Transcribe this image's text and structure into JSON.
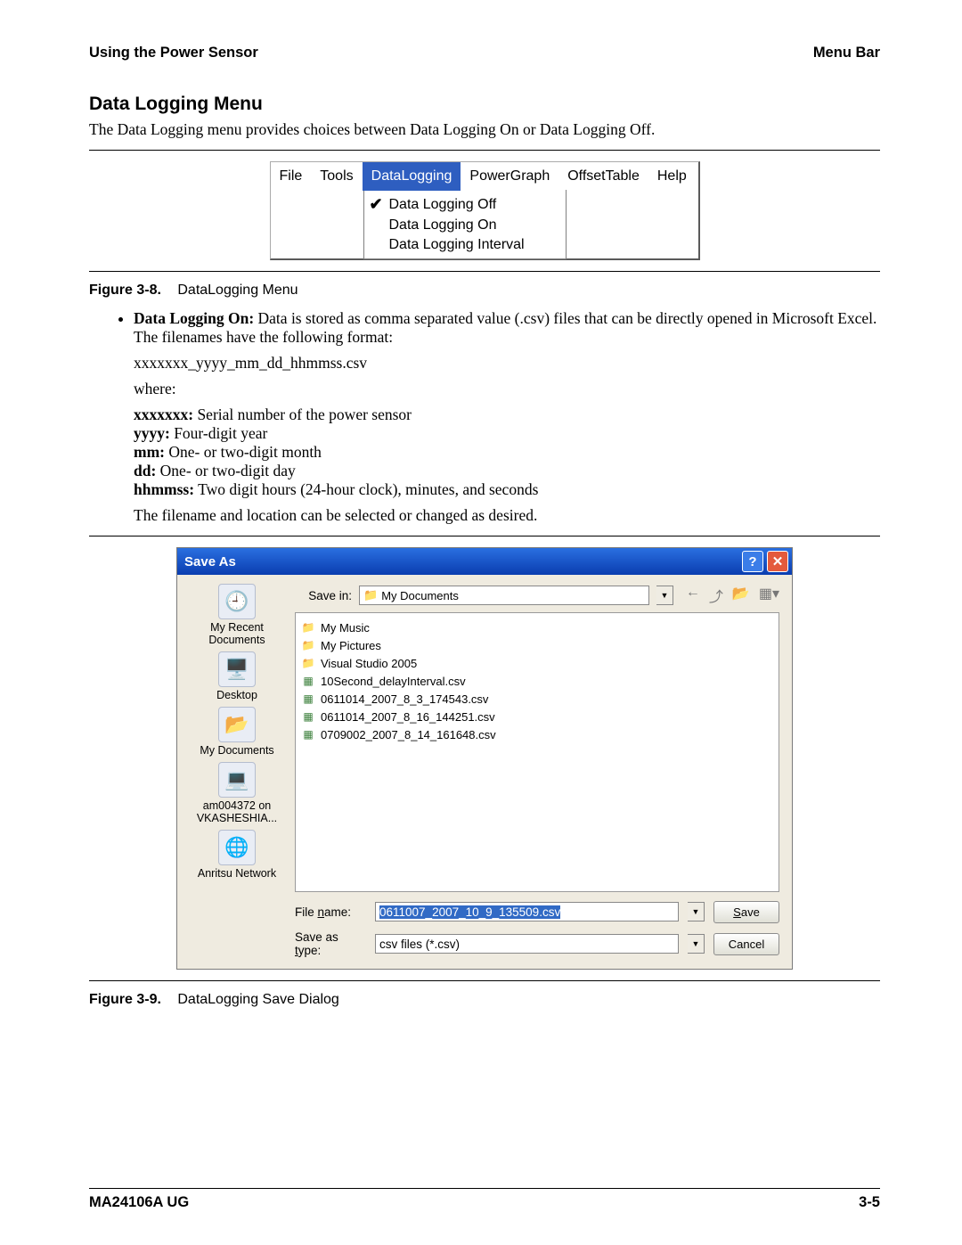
{
  "header": {
    "left": "Using the Power Sensor",
    "right": "Menu Bar"
  },
  "h2": "Data Logging Menu",
  "intro": "The Data Logging menu provides choices between Data Logging On or Data Logging Off.",
  "menubar": {
    "items": [
      "File",
      "Tools",
      "DataLogging",
      "PowerGraph",
      "OffsetTable",
      "Help"
    ],
    "selected": 2,
    "dropdown": [
      {
        "label": "Data Logging Off",
        "checked": true
      },
      {
        "label": "Data Logging On",
        "checked": false
      },
      {
        "label": "Data Logging Interval",
        "checked": false
      }
    ]
  },
  "fig1": {
    "label": "Figure 3-8.",
    "caption": "DataLogging Menu"
  },
  "bullet": {
    "lead": "Data Logging On:",
    "text": " Data is stored as comma separated value (.csv) files that can be directly opened in Microsoft Excel. The filenames have the following format:"
  },
  "fmt": {
    "pattern": "xxxxxxx_yyyy_mm_dd_hhmmss.csv",
    "where": "where:"
  },
  "fields": [
    {
      "k": "xxxxxxx:",
      "v": " Serial number of the power sensor"
    },
    {
      "k": "yyyy:",
      "v": " Four-digit year"
    },
    {
      "k": "mm:",
      "v": " One- or two-digit month"
    },
    {
      "k": "dd:",
      "v": " One- or two-digit day"
    },
    {
      "k": "hhmmss:",
      "v": " Two digit hours (24-hour clock), minutes, and seconds"
    }
  ],
  "closing": "The filename and location can be selected or changed as desired.",
  "dlg": {
    "title": "Save As",
    "savein_lbl": "Save in:",
    "savein_val": "My Documents",
    "places": [
      "My Recent Documents",
      "Desktop",
      "My Documents",
      "am004372 on VKASHESHIA...",
      "Anritsu Network"
    ],
    "files": [
      {
        "t": "f",
        "n": "My Music"
      },
      {
        "t": "f",
        "n": "My Pictures"
      },
      {
        "t": "f",
        "n": "Visual Studio 2005"
      },
      {
        "t": "c",
        "n": "10Second_delayInterval.csv"
      },
      {
        "t": "c",
        "n": "0611014_2007_8_3_174543.csv"
      },
      {
        "t": "c",
        "n": "0611014_2007_8_16_144251.csv"
      },
      {
        "t": "c",
        "n": "0709002_2007_8_14_161648.csv"
      }
    ],
    "fname_lbl": "File name:",
    "fname_lbl_u": "n",
    "fname_val": "0611007_2007_10_9_135509.csv",
    "ftype_lbl": "Save as type:",
    "ftype_lbl_u": "t",
    "ftype_val": "csv files (*.csv)",
    "save": "Save",
    "save_u": "S",
    "cancel": "Cancel"
  },
  "fig2": {
    "label": "Figure 3-9.",
    "caption": "DataLogging Save Dialog"
  },
  "footer": {
    "left": "MA24106A UG",
    "right": "3-5"
  }
}
